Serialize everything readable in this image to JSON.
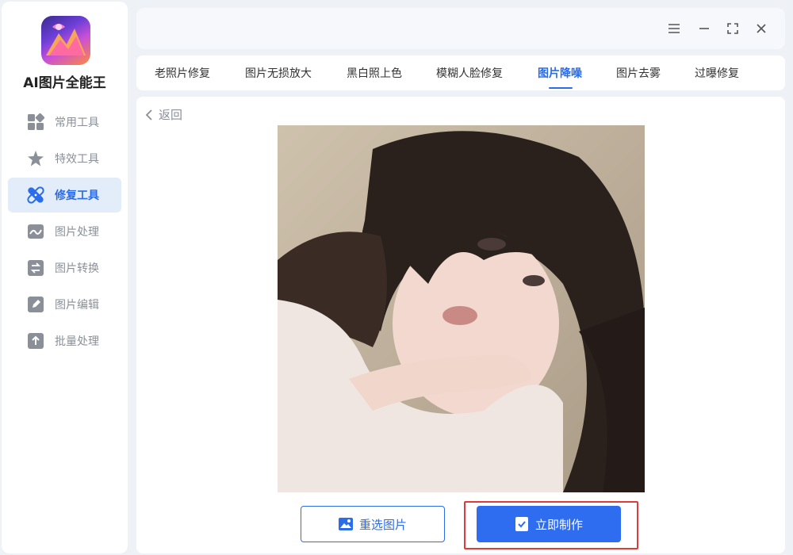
{
  "app": {
    "title": "AI图片全能王"
  },
  "sidebar": {
    "items": [
      {
        "label": "常用工具",
        "icon": "grid-icon"
      },
      {
        "label": "特效工具",
        "icon": "star-icon"
      },
      {
        "label": "修复工具",
        "icon": "bandage-icon",
        "active": true
      },
      {
        "label": "图片处理",
        "icon": "image-wave-icon"
      },
      {
        "label": "图片转换",
        "icon": "convert-icon"
      },
      {
        "label": "图片编辑",
        "icon": "edit-icon"
      },
      {
        "label": "批量处理",
        "icon": "upload-icon"
      }
    ]
  },
  "window_controls": [
    "menu-icon",
    "minimize-icon",
    "maximize-icon",
    "close-icon"
  ],
  "tabs": [
    {
      "label": "老照片修复"
    },
    {
      "label": "图片无损放大"
    },
    {
      "label": "黑白照上色"
    },
    {
      "label": "模糊人脸修复"
    },
    {
      "label": "图片降噪",
      "active": true
    },
    {
      "label": "图片去雾"
    },
    {
      "label": "过曝修复"
    }
  ],
  "content": {
    "back_label": "返回",
    "reselect_label": "重选图片",
    "make_label": "立即制作"
  },
  "colors": {
    "accent": "#2b6de8",
    "primary_button": "#2f6df0",
    "highlight": "#e03a3a",
    "nav_inactive": "#8a8f98"
  }
}
